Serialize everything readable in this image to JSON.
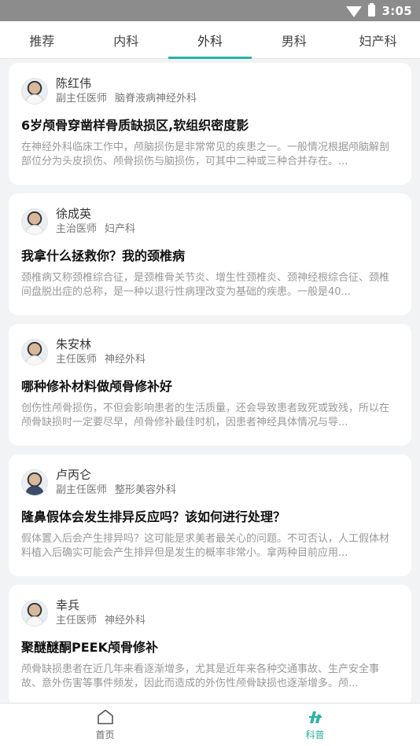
{
  "status": {
    "time": "3:05"
  },
  "tabs": [
    {
      "label": "推荐"
    },
    {
      "label": "内科"
    },
    {
      "label": "外科",
      "active": true
    },
    {
      "label": "男科"
    },
    {
      "label": "妇产科"
    }
  ],
  "articles": [
    {
      "author": "陈红伟",
      "role": "副主任医师",
      "department": "脑脊液病神经外科",
      "title": "6岁颅骨穿凿样骨质缺损区,软组织密度影",
      "excerpt": "在神经外科临床工作中，颅脑损伤是非常常见的疾患之一。一般情况根据颅脑解剖部位分为头皮损伤、颅骨损伤与脑损伤，可其中二种或三种合并存在。..."
    },
    {
      "author": "徐成英",
      "role": "主治医师",
      "department": "妇产科",
      "title": "我拿什么拯救你？我的颈椎病",
      "excerpt": "颈椎病又称颈椎综合征，是颈椎骨关节炎、增生性颈椎炎、颈神经根综合征、颈椎间盘脱出症的总称，是一种以退行性病理改变为基础的疾患。一般是40..."
    },
    {
      "author": "朱安林",
      "role": "主任医师",
      "department": "神经外科",
      "title": "哪种修补材料做颅骨修补好",
      "excerpt": "创伤性颅骨损伤，不但会影响患者的生活质量，还会导致患者致死或致残，所以在颅骨缺损时一定要尽早，颅骨修补最佳时机，因患者神经具体情况与导..."
    },
    {
      "author": "卢丙仑",
      "role": "副主任医师",
      "department": "整形美容外科",
      "title": "隆鼻假体会发生排异反应吗？该如何进行处理？",
      "excerpt": "假体置入后会产生排异吗？这可能是求美者最关心的问题。不可否认，人工假体材料植入后确实可能会产生排异但是发生的概率非常小。拿两种目前应用..."
    },
    {
      "author": "幸兵",
      "role": "主任医师",
      "department": "神经外科",
      "title": "聚醚醚酮PEEK颅骨修补",
      "excerpt": "颅骨缺损患者在近几年来看逐渐增多，尤其是近年来各种交通事故、生产安全事故、意外伤害等事件频发，因此而造成的外伤性颅骨缺损也逐渐增多。颅..."
    }
  ],
  "nav": [
    {
      "label": "首页",
      "icon": "home-icon"
    },
    {
      "label": "科普",
      "icon": "kepu-icon",
      "active": true
    }
  ],
  "colors": {
    "accent": "#2ab3a6",
    "statusbar": "#8c8c8c",
    "background": "#f2f3f5"
  }
}
